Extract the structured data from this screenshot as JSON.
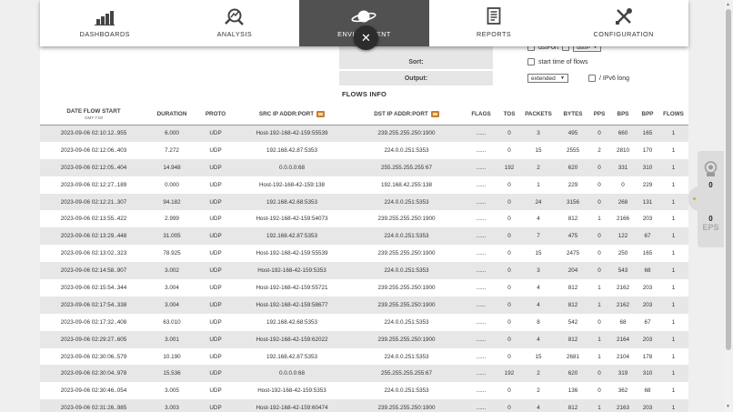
{
  "nav": {
    "items": [
      {
        "label": "DASHBOARDS",
        "icon": "bar-chart-icon",
        "active": false
      },
      {
        "label": "ANALYSIS",
        "icon": "magnifier-analysis-icon",
        "active": false
      },
      {
        "label": "ENVIRONMENT",
        "icon": "planet-icon",
        "active": true
      },
      {
        "label": "REPORTS",
        "icon": "document-report-icon",
        "active": false
      },
      {
        "label": "CONFIGURATION",
        "icon": "wrench-screwdriver-icon",
        "active": false
      }
    ],
    "close_symbol": "✕"
  },
  "filters": {
    "partial": {
      "chk1_label": "dstPort",
      "select_value": "dstIP"
    },
    "sort": {
      "label": "Sort:",
      "checkbox_label": "start time of flows"
    },
    "output": {
      "label": "Output:",
      "select_value": "extended",
      "checkbox_label": "/ IPv6 long"
    }
  },
  "flows": {
    "title": "FLOWS INFO",
    "headers": {
      "date": "DATE FLOW START",
      "date_sub": "GMT-7:00",
      "duration": "DURATION",
      "proto": "PROTO",
      "src": "SRC IP ADDR:PORT",
      "dst": "DST IP ADDR:PORT",
      "flags": "FLAGS",
      "tos": "TOS",
      "packets": "PACKETS",
      "bytes": "BYTES",
      "pps": "PPS",
      "bps": "BPS",
      "bpp": "BPP",
      "flows": "FLOWS"
    },
    "rows": [
      {
        "date": "2023-09-06 02:10:12..955",
        "duration": "6.000",
        "proto": "UDP",
        "src": "Host-192-168-42-159:55539",
        "dst": "239.255.255.250:1900",
        "flags": "......",
        "tos": "0",
        "packets": "3",
        "bytes": "495",
        "pps": "0",
        "bps": "660",
        "bpp": "165",
        "flows": "1"
      },
      {
        "date": "2023-09-06 02:12:06..403",
        "duration": "7.272",
        "proto": "UDP",
        "src": "192.168.42.87:5353",
        "dst": "224.0.0.251:5353",
        "flags": "......",
        "tos": "0",
        "packets": "15",
        "bytes": "2555",
        "pps": "2",
        "bps": "2810",
        "bpp": "170",
        "flows": "1"
      },
      {
        "date": "2023-09-06 02:12:05..404",
        "duration": "14.948",
        "proto": "UDP",
        "src": "0.0.0.0:68",
        "dst": "255.255.255.255:67",
        "flags": "......",
        "tos": "192",
        "packets": "2",
        "bytes": "620",
        "pps": "0",
        "bps": "331",
        "bpp": "310",
        "flows": "1"
      },
      {
        "date": "2023-09-06 02:12:27..189",
        "duration": "0.000",
        "proto": "UDP",
        "src": "Host-192-168-42-159:138",
        "dst": "192.168.42.255:138",
        "flags": "......",
        "tos": "0",
        "packets": "1",
        "bytes": "229",
        "pps": "0",
        "bps": "0",
        "bpp": "229",
        "flows": "1"
      },
      {
        "date": "2023-09-06 02:12:21..307",
        "duration": "94.182",
        "proto": "UDP",
        "src": "192.168.42.68:5353",
        "dst": "224.0.0.251:5353",
        "flags": "......",
        "tos": "0",
        "packets": "24",
        "bytes": "3156",
        "pps": "0",
        "bps": "268",
        "bpp": "131",
        "flows": "1"
      },
      {
        "date": "2023-09-06 02:13:55..422",
        "duration": "2.999",
        "proto": "UDP",
        "src": "Host-192-168-42-159:54073",
        "dst": "239.255.255.250:1900",
        "flags": "......",
        "tos": "0",
        "packets": "4",
        "bytes": "812",
        "pps": "1",
        "bps": "2166",
        "bpp": "203",
        "flows": "1"
      },
      {
        "date": "2023-09-06 02:13:29..448",
        "duration": "31.005",
        "proto": "UDP",
        "src": "192.168.42.87:5353",
        "dst": "224.0.0.251:5353",
        "flags": "......",
        "tos": "0",
        "packets": "7",
        "bytes": "475",
        "pps": "0",
        "bps": "122",
        "bpp": "67",
        "flows": "1"
      },
      {
        "date": "2023-09-06 02:13:02..323",
        "duration": "78.925",
        "proto": "UDP",
        "src": "Host-192-168-42-159:55539",
        "dst": "239.255.255.250:1900",
        "flags": "......",
        "tos": "0",
        "packets": "15",
        "bytes": "2475",
        "pps": "0",
        "bps": "250",
        "bpp": "165",
        "flows": "1"
      },
      {
        "date": "2023-09-06 02:14:58..907",
        "duration": "3.002",
        "proto": "UDP",
        "src": "Host-192-168-42-159:5353",
        "dst": "224.0.0.251:5353",
        "flags": "......",
        "tos": "0",
        "packets": "3",
        "bytes": "204",
        "pps": "0",
        "bps": "543",
        "bpp": "68",
        "flows": "1"
      },
      {
        "date": "2023-09-06 02:15:54..344",
        "duration": "3.004",
        "proto": "UDP",
        "src": "Host-192-168-42-159:55721",
        "dst": "239.255.255.250:1900",
        "flags": "......",
        "tos": "0",
        "packets": "4",
        "bytes": "812",
        "pps": "1",
        "bps": "2162",
        "bpp": "203",
        "flows": "1"
      },
      {
        "date": "2023-09-06 02:17:54..338",
        "duration": "3.004",
        "proto": "UDP",
        "src": "Host-192-168-42-159:58677",
        "dst": "239.255.255.250:1900",
        "flags": "......",
        "tos": "0",
        "packets": "4",
        "bytes": "812",
        "pps": "1",
        "bps": "2162",
        "bpp": "203",
        "flows": "1"
      },
      {
        "date": "2023-09-06 02:17:32..408",
        "duration": "63.010",
        "proto": "UDP",
        "src": "192.168.42.68:5353",
        "dst": "224.0.0.251:5353",
        "flags": "......",
        "tos": "0",
        "packets": "8",
        "bytes": "542",
        "pps": "0",
        "bps": "68",
        "bpp": "67",
        "flows": "1"
      },
      {
        "date": "2023-09-06 02:29:27..605",
        "duration": "3.001",
        "proto": "UDP",
        "src": "Host-192-168-42-159:62022",
        "dst": "239.255.255.250:1900",
        "flags": "......",
        "tos": "0",
        "packets": "4",
        "bytes": "812",
        "pps": "1",
        "bps": "2164",
        "bpp": "203",
        "flows": "1"
      },
      {
        "date": "2023-09-06 02:30:06..579",
        "duration": "10.190",
        "proto": "UDP",
        "src": "192.168.42.87:5353",
        "dst": "224.0.0.251:5353",
        "flags": "......",
        "tos": "0",
        "packets": "15",
        "bytes": "2681",
        "pps": "1",
        "bps": "2104",
        "bpp": "178",
        "flows": "1"
      },
      {
        "date": "2023-09-06 02:30:04..978",
        "duration": "15.536",
        "proto": "UDP",
        "src": "0.0.0.0:68",
        "dst": "255.255.255.255:67",
        "flags": "......",
        "tos": "192",
        "packets": "2",
        "bytes": "620",
        "pps": "0",
        "bps": "319",
        "bpp": "310",
        "flows": "1"
      },
      {
        "date": "2023-09-06 02:30:46..054",
        "duration": "3.005",
        "proto": "UDP",
        "src": "Host-192-168-42-159:5353",
        "dst": "224.0.0.251:5353",
        "flags": "......",
        "tos": "0",
        "packets": "2",
        "bytes": "136",
        "pps": "0",
        "bps": "362",
        "bpp": "68",
        "flows": "1"
      },
      {
        "date": "2023-09-06 02:31:26..985",
        "duration": "3.003",
        "proto": "UDP",
        "src": "Host-192-168-42-159:60474",
        "dst": "239.255.255.250:1900",
        "flags": "......",
        "tos": "0",
        "packets": "4",
        "bytes": "812",
        "pps": "1",
        "bps": "2163",
        "bpp": "203",
        "flows": "1"
      }
    ]
  },
  "side_widget": {
    "count": "0",
    "eps_value": "0",
    "eps_label": "EPS"
  },
  "colors": {
    "nav_active_bg": "#515151",
    "row_alt": "#e7e7e7",
    "accent_dot": "#e0b000"
  }
}
